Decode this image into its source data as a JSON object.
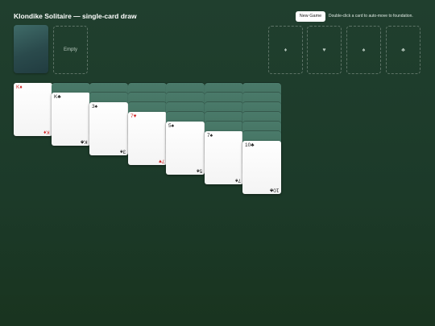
{
  "header": {
    "title": "Klondike Solitaire — single-card draw",
    "new_game_label": "New Game",
    "hint": "Double-click a card to auto-move to foundation."
  },
  "waste": {
    "empty_label": "Empty"
  },
  "foundations": [
    {
      "suit": "diamonds",
      "symbol": "♦"
    },
    {
      "suit": "hearts",
      "symbol": "♥"
    },
    {
      "suit": "spades",
      "symbol": "♠"
    },
    {
      "suit": "clubs",
      "symbol": "♣"
    }
  ],
  "tableau": [
    {
      "facedown": 0,
      "top": {
        "rank": "K",
        "suit": "♦",
        "color": "red"
      }
    },
    {
      "facedown": 1,
      "top": {
        "rank": "K",
        "suit": "♣",
        "color": "black"
      }
    },
    {
      "facedown": 2,
      "top": {
        "rank": "3",
        "suit": "♠",
        "color": "black"
      }
    },
    {
      "facedown": 3,
      "top": {
        "rank": "7",
        "suit": "♥",
        "color": "red"
      }
    },
    {
      "facedown": 4,
      "top": {
        "rank": "5",
        "suit": "♠",
        "color": "black"
      }
    },
    {
      "facedown": 5,
      "top": {
        "rank": "7",
        "suit": "♠",
        "color": "black"
      }
    },
    {
      "facedown": 6,
      "top": {
        "rank": "10",
        "suit": "♣",
        "color": "black"
      }
    }
  ],
  "colors": {
    "felt": "#1c3a29",
    "red_suit": "#d12a2a",
    "black_suit": "#1e1e1e"
  }
}
